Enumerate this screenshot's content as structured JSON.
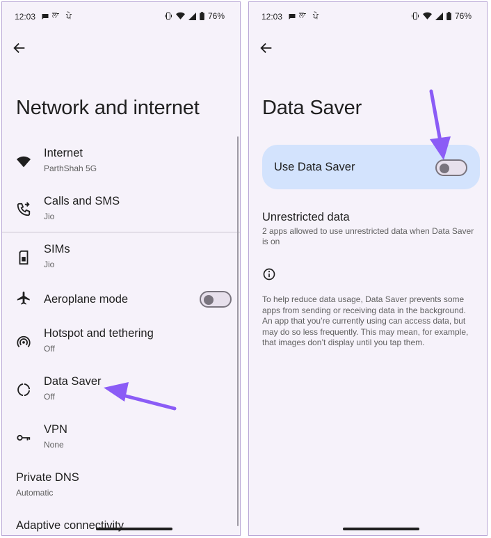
{
  "left_screen": {
    "status_bar": {
      "time": "12:03",
      "network_text": "ਲਾ",
      "network_text2": "ਪੇ",
      "battery": "76%"
    },
    "title": "Network and internet",
    "items": [
      {
        "title": "Internet",
        "subtitle": "ParthShah 5G",
        "icon": "wifi-icon"
      },
      {
        "title": "Calls and SMS",
        "subtitle": "Jio",
        "icon": "phone-forward-icon"
      },
      {
        "title": "SIMs",
        "subtitle": "Jio",
        "icon": "sim-card-icon"
      },
      {
        "title": "Aeroplane mode",
        "subtitle": "",
        "icon": "airplane-icon",
        "toggle": "off"
      },
      {
        "title": "Hotspot and tethering",
        "subtitle": "Off",
        "icon": "hotspot-icon"
      },
      {
        "title": "Data Saver",
        "subtitle": "Off",
        "icon": "data-saver-icon"
      },
      {
        "title": "VPN",
        "subtitle": "None",
        "icon": "vpn-key-icon"
      },
      {
        "title": "Private DNS",
        "subtitle": "Automatic"
      },
      {
        "title": "Adaptive connectivity",
        "subtitle": ""
      }
    ]
  },
  "right_screen": {
    "status_bar": {
      "time": "12:03",
      "network_text": "ਲਾ",
      "network_text2": "ਪੇ",
      "battery": "76%"
    },
    "title": "Data Saver",
    "use_data_saver": {
      "label": "Use Data Saver",
      "toggle": "off"
    },
    "unrestricted": {
      "title": "Unrestricted data",
      "subtitle": "2 apps allowed to use unrestricted data when Data Saver is on"
    },
    "info_text": "To help reduce data usage, Data Saver prevents some apps from sending or receiving data in the background. An app that you’re currently using can access data, but may do so less frequently. This may mean, for example, that images don’t display until you tap them."
  },
  "colors": {
    "arrow": "#8b5cf6",
    "card": "#d3e3fd",
    "background": "#f6f2fa"
  }
}
